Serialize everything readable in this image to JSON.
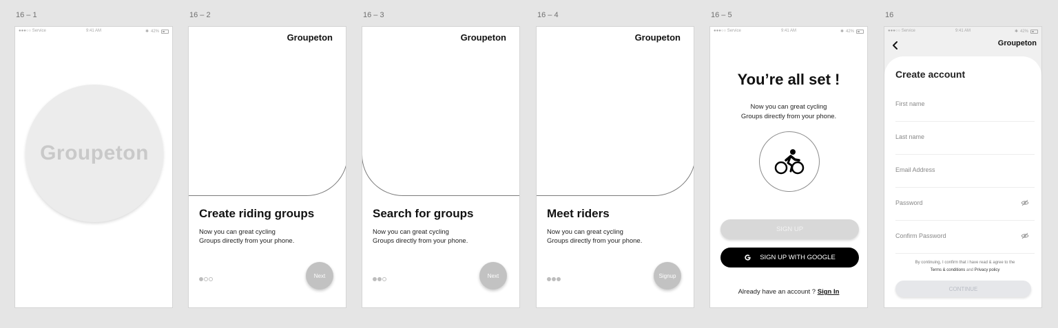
{
  "artboards": [
    {
      "label": "16 – 1"
    },
    {
      "label": "16 – 2"
    },
    {
      "label": "16 – 3"
    },
    {
      "label": "16 – 4"
    },
    {
      "label": "16 – 5"
    },
    {
      "label": "16"
    }
  ],
  "status_bar": {
    "carrier": "●●●○○ Service",
    "time": "9:41 AM",
    "battery": "42%"
  },
  "splash": {
    "logo": "Groupeton"
  },
  "onboarding": [
    {
      "brand": "Groupeton",
      "title": "Create riding groups",
      "desc_line1": "Now you can great cycling",
      "desc_line2": "Groups directly from your phone.",
      "button": "Next",
      "active_dots": 1
    },
    {
      "brand": "Groupeton",
      "title": "Search for groups",
      "desc_line1": "Now you can great cycling",
      "desc_line2": "Groups directly from your phone.",
      "button": "Next",
      "active_dots": 2
    },
    {
      "brand": "Groupeton",
      "title": "Meet riders",
      "desc_line1": "Now you can great cycling",
      "desc_line2": "Groups directly from your phone.",
      "button": "Signup",
      "active_dots": 3
    }
  ],
  "welcome": {
    "title": "You’re all set !",
    "desc_line1": "Now you can great cycling",
    "desc_line2": "Groups directly from your phone.",
    "icon": "bicycle-icon",
    "signup_label": "SIGN UP",
    "google_label": "SIGN UP WITH GOOGLE",
    "already_text": "Already have an account ?",
    "signin_label": "Sign In"
  },
  "create_account": {
    "brand": "Groupeton",
    "title": "Create account",
    "fields": [
      {
        "placeholder": "First name"
      },
      {
        "placeholder": "Last name"
      },
      {
        "placeholder": "Email Address"
      },
      {
        "placeholder": "Password"
      },
      {
        "placeholder": "Confirm Password"
      }
    ],
    "consent_line1": "By continuing, I confirm that i have read & agree to the",
    "terms_label": "Terms & conditions",
    "and_text": "and",
    "privacy_label": "Privacy policy",
    "continue_label": "CONTINUE"
  },
  "colors": {
    "background": "#e5e5e5",
    "primary_dark": "#000000",
    "disabled": "#d8d8d8",
    "next_button": "#c2c2c2"
  }
}
